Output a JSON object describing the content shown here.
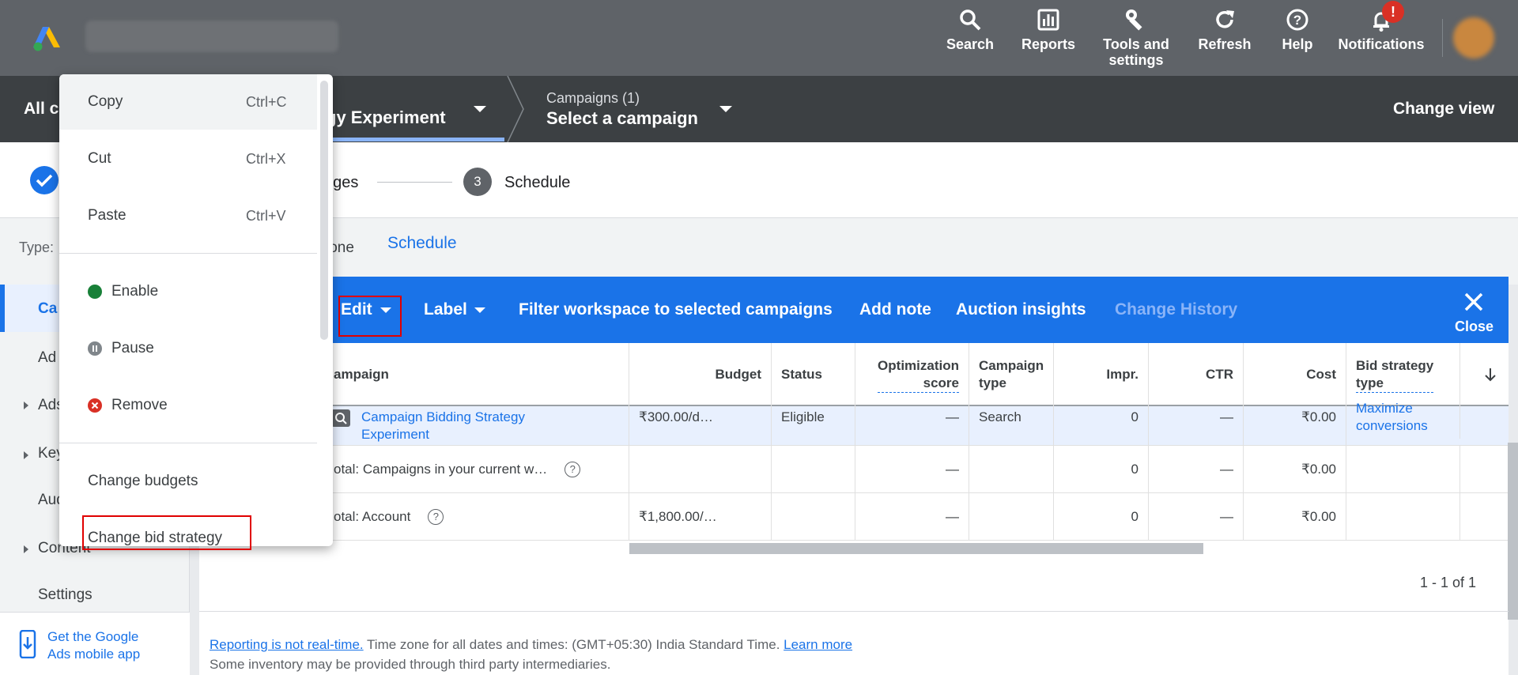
{
  "topbar": {
    "tools": [
      {
        "label": "Search",
        "icon": "search-icon"
      },
      {
        "label": "Reports",
        "icon": "reports-icon"
      },
      {
        "label": "Tools and settings",
        "icon": "wrench-icon"
      },
      {
        "label": "Refresh",
        "icon": "refresh-icon"
      },
      {
        "label": "Help",
        "icon": "help-icon"
      },
      {
        "label": "Notifications",
        "icon": "bell-icon"
      }
    ],
    "notification_badge": "!"
  },
  "navbar": {
    "all_campaigns": "All ca",
    "experiment": "gy Experiment",
    "campaigns_count": "Campaigns (1)",
    "select_campaign": "Select a campaign",
    "change_view": "Change view"
  },
  "stepper": {
    "step2_partial": "nges",
    "step3_number": "3",
    "step3_label": "Schedule"
  },
  "typerow": {
    "type_label": "Type:",
    "none_label": "lone",
    "schedule_tab": "Schedule"
  },
  "leftnav": {
    "items": [
      {
        "label": "Ca",
        "active": true
      },
      {
        "label": "Ad"
      },
      {
        "label": "Ads",
        "expandable": true
      },
      {
        "label": "Key",
        "expandable": true
      },
      {
        "label": "Aud"
      },
      {
        "label": "Content",
        "expandable": true
      },
      {
        "label": "Settings"
      }
    ],
    "mobile_app_line1": "Get the Google",
    "mobile_app_line2": "Ads mobile app"
  },
  "action_bar": {
    "edit": "Edit",
    "label": "Label",
    "filter": "Filter workspace to selected campaigns",
    "add_note": "Add note",
    "auction": "Auction insights",
    "change_history": "Change History",
    "close": "Close"
  },
  "table": {
    "headers": {
      "campaign": "ampaign",
      "budget": "Budget",
      "status": "Status",
      "opt_score_1": "Optimization",
      "opt_score_2": "score",
      "campaign_type_1": "Campaign",
      "campaign_type_2": "type",
      "impr": "Impr.",
      "ctr": "CTR",
      "cost": "Cost",
      "bid_type_1": "Bid strategy",
      "bid_type_2": "type"
    },
    "rows": [
      {
        "campaign_line1": "Campaign Bidding Strategy",
        "campaign_line2": "Experiment",
        "budget": "₹300.00/d…",
        "status": "Eligible",
        "opt_score": "—",
        "campaign_type": "Search",
        "impr": "0",
        "ctr": "—",
        "cost": "₹0.00",
        "bid_line1": "Maximize",
        "bid_line2": "conversions"
      },
      {
        "campaign": "otal: Campaigns in your current w…",
        "opt_score": "—",
        "impr": "0",
        "ctr": "—",
        "cost": "₹0.00"
      },
      {
        "campaign": "otal: Account",
        "budget": "₹1,800.00/…",
        "opt_score": "—",
        "impr": "0",
        "ctr": "—",
        "cost": "₹0.00"
      }
    ],
    "pager": "1 - 1 of 1"
  },
  "footer": {
    "reporting_link": "Reporting is not real-time.",
    "timezone": " Time zone for all dates and times: (GMT+05:30) India Standard Time. ",
    "learn_more": "Learn more",
    "inventory": "Some inventory may be provided through third party intermediaries."
  },
  "context_menu": {
    "items": [
      {
        "label": "Copy",
        "shortcut": "Ctrl+C"
      },
      {
        "label": "Cut",
        "shortcut": "Ctrl+X"
      },
      {
        "label": "Paste",
        "shortcut": "Ctrl+V"
      },
      {
        "label": "Enable",
        "icon": "enable-dot-icon"
      },
      {
        "label": "Pause",
        "icon": "pause-icon"
      },
      {
        "label": "Remove",
        "icon": "remove-icon"
      },
      {
        "label": "Change budgets"
      },
      {
        "label": "Change bid strategy"
      }
    ]
  },
  "colors": {
    "topbar": "#5f6368",
    "navbar": "#3c4043",
    "accent": "#1a73e8",
    "enable": "#188038",
    "remove": "#d93025",
    "highlight_box": "#e00000"
  }
}
